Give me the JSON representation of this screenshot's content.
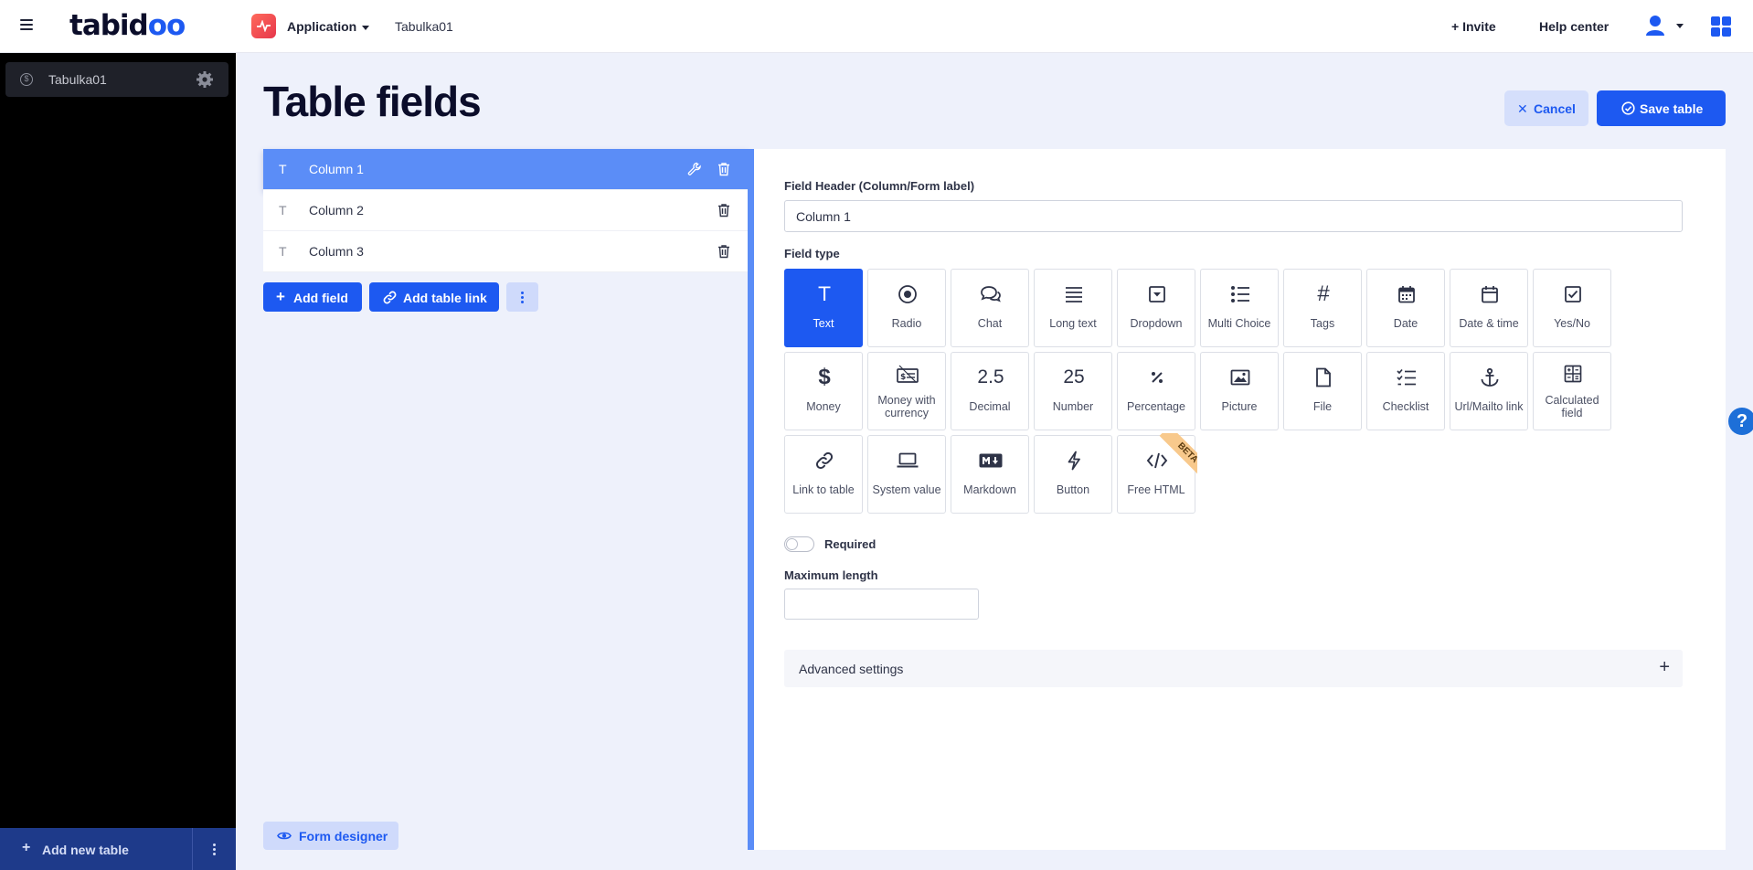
{
  "topbar": {
    "logo_main": "tabid",
    "logo_accent": "oo",
    "app_name": "Application",
    "table_crumb": "Tabulka01",
    "invite_label": "Invite",
    "help_label": "Help center"
  },
  "sidebar": {
    "items": [
      {
        "label": "Tabulka01"
      }
    ],
    "add_table_label": "Add new table"
  },
  "page": {
    "title": "Table fields",
    "cancel_label": "Cancel",
    "save_label": "Save table"
  },
  "columns": [
    {
      "type_glyph": "T",
      "name": "Column 1",
      "active": true
    },
    {
      "type_glyph": "T",
      "name": "Column 2",
      "active": false
    },
    {
      "type_glyph": "T",
      "name": "Column 3",
      "active": false
    }
  ],
  "list_actions": {
    "add_field_label": "Add field",
    "add_link_label": "Add table link",
    "form_designer_label": "Form designer"
  },
  "panel": {
    "header_label": "Field Header (Column/Form label)",
    "header_value": "Column 1",
    "field_type_label": "Field type",
    "field_types": [
      {
        "label": "Text",
        "icon": "text-icon",
        "active": true
      },
      {
        "label": "Radio",
        "icon": "radio-icon"
      },
      {
        "label": "Chat",
        "icon": "chat-icon"
      },
      {
        "label": "Long text",
        "icon": "long-text-icon"
      },
      {
        "label": "Dropdown",
        "icon": "dropdown-icon"
      },
      {
        "label": "Multi Choice",
        "icon": "multi-choice-icon"
      },
      {
        "label": "Tags",
        "icon": "hash-icon"
      },
      {
        "label": "Date",
        "icon": "calendar-icon"
      },
      {
        "label": "Date & time",
        "icon": "calendar-time-icon"
      },
      {
        "label": "Yes/No",
        "icon": "checkbox-icon"
      },
      {
        "label": "Money",
        "icon": "dollar-icon"
      },
      {
        "label": "Money with currency",
        "icon": "money-currency-icon"
      },
      {
        "label": "Decimal",
        "icon": "decimal-icon",
        "glyph": "2.5"
      },
      {
        "label": "Number",
        "icon": "number-icon",
        "glyph": "25"
      },
      {
        "label": "Percentage",
        "icon": "percentage-icon"
      },
      {
        "label": "Picture",
        "icon": "picture-icon"
      },
      {
        "label": "File",
        "icon": "file-icon"
      },
      {
        "label": "Checklist",
        "icon": "checklist-icon"
      },
      {
        "label": "Url/Mailto link",
        "icon": "anchor-icon"
      },
      {
        "label": "Calculated field",
        "icon": "calculator-icon"
      },
      {
        "label": "Link to table",
        "icon": "link-icon"
      },
      {
        "label": "System value",
        "icon": "laptop-icon"
      },
      {
        "label": "Markdown",
        "icon": "markdown-icon"
      },
      {
        "label": "Button",
        "icon": "bolt-icon"
      },
      {
        "label": "Free HTML",
        "icon": "code-icon",
        "badge": "BETA"
      }
    ],
    "required_label": "Required",
    "required_on": false,
    "max_length_label": "Maximum length",
    "max_length_value": "",
    "advanced_label": "Advanced settings"
  },
  "help_bubble": "?",
  "colors": {
    "accent": "#1d59f1",
    "active_row": "#5b8df7",
    "sidebar": "#000000"
  }
}
